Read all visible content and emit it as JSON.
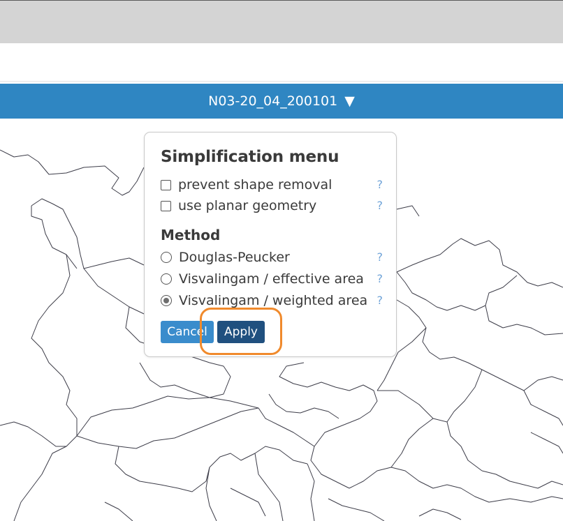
{
  "layer_bar": {
    "name": "N03-20_04_200101",
    "caret": "▼"
  },
  "dialog": {
    "title": "Simplification menu",
    "options": [
      {
        "label": "prevent shape removal",
        "checked": false,
        "help": "?"
      },
      {
        "label": "use planar geometry",
        "checked": false,
        "help": "?"
      }
    ],
    "method_label": "Method",
    "methods": [
      {
        "label": "Douglas-Peucker",
        "selected": false,
        "help": "?"
      },
      {
        "label": "Visvalingam / effective area",
        "selected": false,
        "help": "?"
      },
      {
        "label": "Visvalingam / weighted area",
        "selected": true,
        "help": "?"
      }
    ],
    "cancel_label": "Cancel",
    "apply_label": "Apply"
  },
  "colors": {
    "layer_bar": "#2f86c2",
    "apply_button": "#20507f",
    "cancel_button": "#3a8ccc",
    "highlight": "#f08a2c",
    "help": "#6fa3d8"
  }
}
